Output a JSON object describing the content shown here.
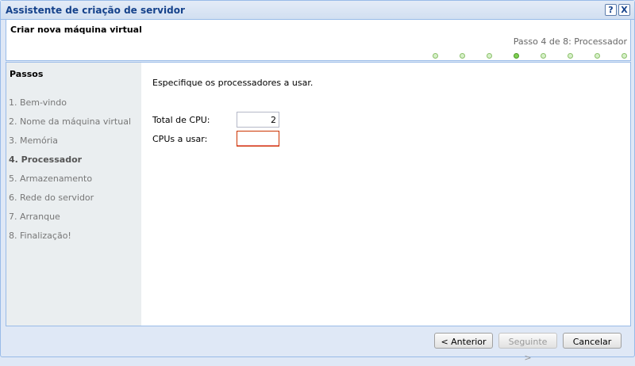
{
  "window": {
    "title": "Assistente de criação de servidor",
    "help_label": "?",
    "close_label": "X"
  },
  "header": {
    "title": "Criar nova máquina virtual",
    "step_caption": "Passo 4 de 8: Processador",
    "total_steps": 8,
    "current_step": 4
  },
  "sidebar": {
    "title": "Passos",
    "items": [
      {
        "label": "1. Bem-vindo"
      },
      {
        "label": "2. Nome da máquina virtual"
      },
      {
        "label": "3. Memória"
      },
      {
        "label": "4. Processador"
      },
      {
        "label": "5. Armazenamento"
      },
      {
        "label": "6. Rede do servidor"
      },
      {
        "label": "7. Arranque"
      },
      {
        "label": "8. Finalização!"
      }
    ]
  },
  "main": {
    "instruction": "Especifique os processadores a usar.",
    "total_cpu_label": "Total de CPU:",
    "total_cpu_value": "2",
    "cpus_to_use_label": "CPUs a usar:",
    "cpus_to_use_value": ""
  },
  "footer": {
    "back_label": "< Anterior",
    "next_label": "Seguinte >",
    "cancel_label": "Cancelar"
  },
  "colors": {
    "accent": "#15428b",
    "border": "#99bbe8",
    "step_done": "#d6f0c8",
    "step_current": "#7fcf52",
    "invalid": "#cc3300"
  }
}
